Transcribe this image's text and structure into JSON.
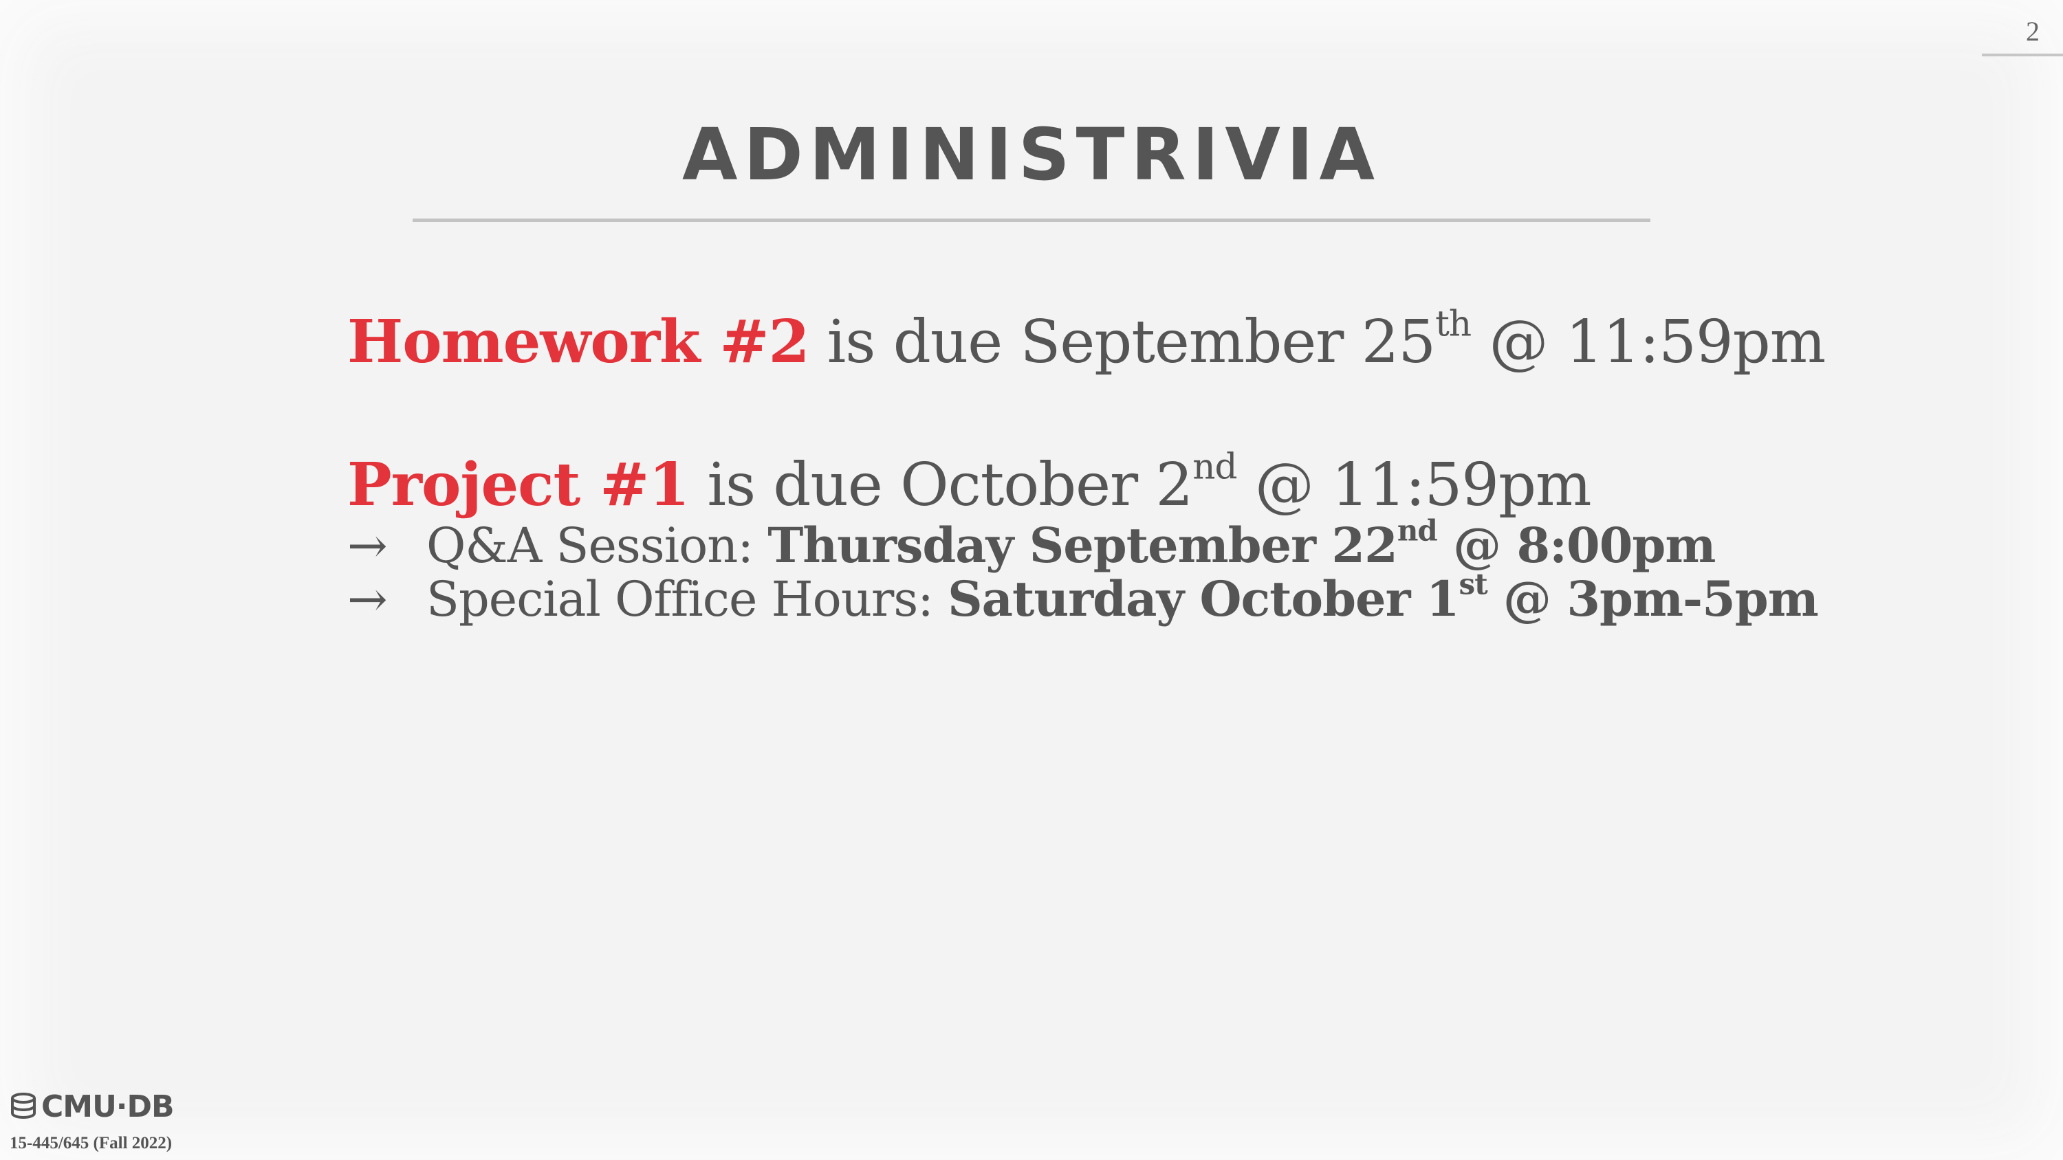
{
  "slide": {
    "page_number": "2",
    "title": "ADMINISTRIVIA"
  },
  "homework": {
    "label": "Homework #2",
    "text": " is due September 25",
    "sup": "th",
    "tail": " @ 11:59pm"
  },
  "project": {
    "label": "Project #1",
    "text": " is due October 2",
    "sup": "nd",
    "tail": " @ 11:59pm",
    "bullets": [
      {
        "arrow": "→",
        "prefix": "Q&A Session: ",
        "bold": "Thursday September 22",
        "sup": "nd",
        "bold_tail": " @ 8:00pm"
      },
      {
        "arrow": "→",
        "prefix": "Special Office Hours: ",
        "bold": "Saturday October 1",
        "sup": "st",
        "bold_tail": " @ 3pm-5pm"
      }
    ]
  },
  "footer": {
    "logo_text": "CMU·DB",
    "logo_icon": "database-icon",
    "course": "15-445/645 (Fall 2022)"
  },
  "colors": {
    "accent_red": "#e3333b",
    "text_gray": "#555555",
    "background": "#f3f3f3"
  }
}
